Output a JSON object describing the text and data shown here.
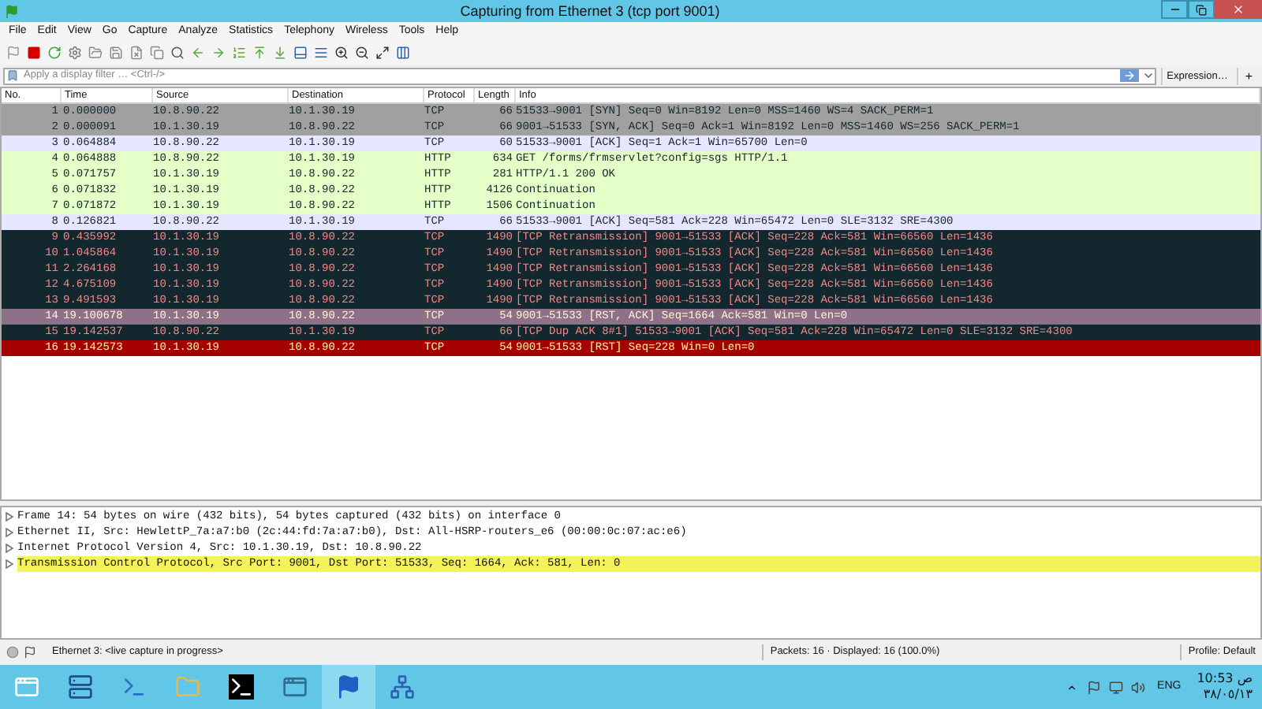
{
  "window": {
    "title": "Capturing from Ethernet 3 (tcp port 9001)"
  },
  "menu": [
    "File",
    "Edit",
    "View",
    "Go",
    "Capture",
    "Analyze",
    "Statistics",
    "Telephony",
    "Wireless",
    "Tools",
    "Help"
  ],
  "filter": {
    "placeholder": "Apply a display filter … <Ctrl-/>",
    "expression": "Expression…",
    "add": "+"
  },
  "columns": [
    "No.",
    "Time",
    "Source",
    "Destination",
    "Protocol",
    "Length",
    "Info"
  ],
  "rows": [
    {
      "no": "1",
      "time": "0.000000",
      "source": "10.8.90.22",
      "destination": "10.1.30.19",
      "protocol": "TCP",
      "length": "66",
      "info": "51533→9001 [SYN] Seq=0 Win=8192 Len=0 MSS=1460 WS=4 SACK_PERM=1",
      "kind": "syn",
      "selected": false
    },
    {
      "no": "2",
      "time": "0.000091",
      "source": "10.1.30.19",
      "destination": "10.8.90.22",
      "protocol": "TCP",
      "length": "66",
      "info": "9001→51533 [SYN, ACK] Seq=0 Ack=1 Win=8192 Len=0 MSS=1460 WS=256 SACK_PERM=1",
      "kind": "syn",
      "selected": false
    },
    {
      "no": "3",
      "time": "0.064884",
      "source": "10.8.90.22",
      "destination": "10.1.30.19",
      "protocol": "TCP",
      "length": "60",
      "info": "51533→9001 [ACK] Seq=1 Ack=1 Win=65700 Len=0",
      "kind": "tcp",
      "selected": false
    },
    {
      "no": "4",
      "time": "0.064888",
      "source": "10.8.90.22",
      "destination": "10.1.30.19",
      "protocol": "HTTP",
      "length": "634",
      "info": "GET /forms/frmservlet?config=sgs HTTP/1.1",
      "kind": "http",
      "selected": false
    },
    {
      "no": "5",
      "time": "0.071757",
      "source": "10.1.30.19",
      "destination": "10.8.90.22",
      "protocol": "HTTP",
      "length": "281",
      "info": "HTTP/1.1 200 OK",
      "kind": "http",
      "selected": false
    },
    {
      "no": "6",
      "time": "0.071832",
      "source": "10.1.30.19",
      "destination": "10.8.90.22",
      "protocol": "HTTP",
      "length": "4126",
      "info": "Continuation",
      "kind": "http",
      "selected": false
    },
    {
      "no": "7",
      "time": "0.071872",
      "source": "10.1.30.19",
      "destination": "10.8.90.22",
      "protocol": "HTTP",
      "length": "1506",
      "info": "Continuation",
      "kind": "http",
      "selected": false
    },
    {
      "no": "8",
      "time": "0.126821",
      "source": "10.8.90.22",
      "destination": "10.1.30.19",
      "protocol": "TCP",
      "length": "66",
      "info": "51533→9001 [ACK] Seq=581 Ack=228 Win=65472 Len=0 SLE=3132 SRE=4300",
      "kind": "tcp",
      "selected": false
    },
    {
      "no": "9",
      "time": "0.435992",
      "source": "10.1.30.19",
      "destination": "10.8.90.22",
      "protocol": "TCP",
      "length": "1490",
      "info": "[TCP Retransmission] 9001→51533 [ACK] Seq=228 Ack=581 Win=66560 Len=1436",
      "kind": "bad",
      "selected": false
    },
    {
      "no": "10",
      "time": "1.045864",
      "source": "10.1.30.19",
      "destination": "10.8.90.22",
      "protocol": "TCP",
      "length": "1490",
      "info": "[TCP Retransmission] 9001→51533 [ACK] Seq=228 Ack=581 Win=66560 Len=1436",
      "kind": "bad",
      "selected": false
    },
    {
      "no": "11",
      "time": "2.264168",
      "source": "10.1.30.19",
      "destination": "10.8.90.22",
      "protocol": "TCP",
      "length": "1490",
      "info": "[TCP Retransmission] 9001→51533 [ACK] Seq=228 Ack=581 Win=66560 Len=1436",
      "kind": "bad",
      "selected": false
    },
    {
      "no": "12",
      "time": "4.675109",
      "source": "10.1.30.19",
      "destination": "10.8.90.22",
      "protocol": "TCP",
      "length": "1490",
      "info": "[TCP Retransmission] 9001→51533 [ACK] Seq=228 Ack=581 Win=66560 Len=1436",
      "kind": "bad",
      "selected": false
    },
    {
      "no": "13",
      "time": "9.491593",
      "source": "10.1.30.19",
      "destination": "10.8.90.22",
      "protocol": "TCP",
      "length": "1490",
      "info": "[TCP Retransmission] 9001→51533 [ACK] Seq=228 Ack=581 Win=66560 Len=1436",
      "kind": "bad",
      "selected": false
    },
    {
      "no": "14",
      "time": "19.100678",
      "source": "10.1.30.19",
      "destination": "10.8.90.22",
      "protocol": "TCP",
      "length": "54",
      "info": "9001→51533 [RST, ACK] Seq=1664 Ack=581 Win=0 Len=0",
      "kind": "rst",
      "selected": true
    },
    {
      "no": "15",
      "time": "19.142537",
      "source": "10.8.90.22",
      "destination": "10.1.30.19",
      "protocol": "TCP",
      "length": "66",
      "info": "[TCP Dup ACK 8#1] 51533→9001 [ACK] Seq=581 Ack=228 Win=65472 Len=0 SLE=3132 SRE=4300",
      "kind": "bad",
      "selected": false
    },
    {
      "no": "16",
      "time": "19.142573",
      "source": "10.1.30.19",
      "destination": "10.8.90.22",
      "protocol": "TCP",
      "length": "54",
      "info": "9001→51533 [RST] Seq=228 Win=0 Len=0",
      "kind": "rst",
      "selected": false
    }
  ],
  "details": [
    {
      "text": "Frame 14: 54 bytes on wire (432 bits), 54 bytes captured (432 bits) on interface 0",
      "selected": false
    },
    {
      "text": "Ethernet II, Src: HewlettP_7a:a7:b0 (2c:44:fd:7a:a7:b0), Dst: All-HSRP-routers_e6 (00:00:0c:07:ac:e6)",
      "selected": false
    },
    {
      "text": "Internet Protocol Version 4, Src: 10.1.30.19, Dst: 10.8.90.22",
      "selected": false
    },
    {
      "text": "Transmission Control Protocol, Src Port: 9001, Dst Port: 51533, Seq: 1664, Ack: 581, Len: 0",
      "selected": true
    }
  ],
  "status_bar": {
    "capture": "Ethernet 3: <live capture in progress>",
    "packets": "Packets: 16 · Displayed: 16 (100.0%)",
    "profile": "Profile: Default"
  },
  "taskbar": {
    "apps": [
      {
        "kind": "start",
        "selected": false
      },
      {
        "kind": "server",
        "selected": false
      },
      {
        "kind": "powershell",
        "selected": false
      },
      {
        "kind": "folder",
        "selected": false
      },
      {
        "kind": "terminal",
        "selected": false
      },
      {
        "kind": "window",
        "selected": false
      },
      {
        "kind": "wireshark",
        "selected": true
      },
      {
        "kind": "network",
        "selected": false
      }
    ],
    "language": "ENG",
    "time": "10:53 ص",
    "date": "٣٨/٠٥/١٣"
  }
}
